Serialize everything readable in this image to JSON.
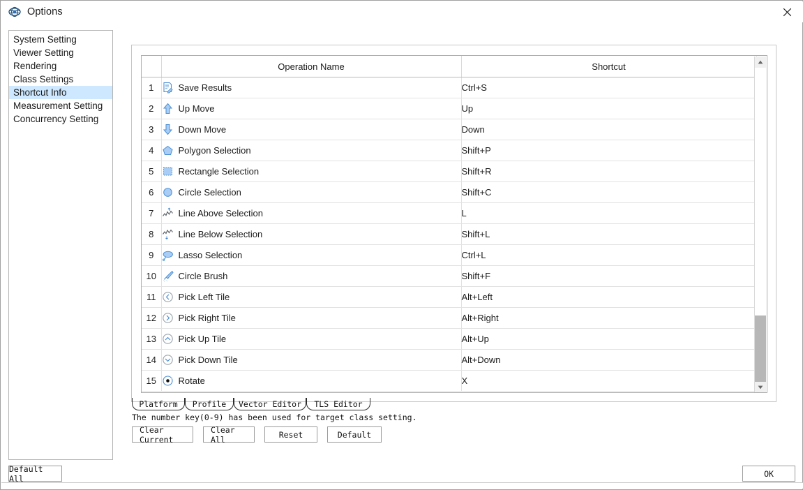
{
  "window": {
    "title": "Options",
    "app_icon": "app-logo-icon",
    "close_label": "✕"
  },
  "sidebar": {
    "items": [
      {
        "label": "System Setting",
        "selected": false
      },
      {
        "label": "Viewer Setting",
        "selected": false
      },
      {
        "label": "Rendering",
        "selected": false
      },
      {
        "label": "Class Settings",
        "selected": false
      },
      {
        "label": "Shortcut Info",
        "selected": true
      },
      {
        "label": "Measurement Setting",
        "selected": false
      },
      {
        "label": "Concurrency Setting",
        "selected": false
      }
    ],
    "selected_index": 4,
    "selection_color": "#cde8ff"
  },
  "table": {
    "headers": {
      "index": "",
      "operation": "Operation Name",
      "shortcut": "Shortcut"
    },
    "rows": [
      {
        "num": "1",
        "icon": "save-results-icon",
        "operation": "Save Results",
        "shortcut": "Ctrl+S"
      },
      {
        "num": "2",
        "icon": "arrow-up-icon",
        "operation": "Up Move",
        "shortcut": "Up"
      },
      {
        "num": "3",
        "icon": "arrow-down-icon",
        "operation": "Down Move",
        "shortcut": "Down"
      },
      {
        "num": "4",
        "icon": "polygon-icon",
        "operation": "Polygon Selection",
        "shortcut": "Shift+P"
      },
      {
        "num": "5",
        "icon": "rectangle-icon",
        "operation": "Rectangle Selection",
        "shortcut": "Shift+R"
      },
      {
        "num": "6",
        "icon": "circle-icon",
        "operation": "Circle Selection",
        "shortcut": "Shift+C"
      },
      {
        "num": "7",
        "icon": "line-above-icon",
        "operation": "Line Above Selection",
        "shortcut": "L"
      },
      {
        "num": "8",
        "icon": "line-below-icon",
        "operation": "Line Below Selection",
        "shortcut": "Shift+L"
      },
      {
        "num": "9",
        "icon": "lasso-icon",
        "operation": "Lasso Selection",
        "shortcut": "Ctrl+L"
      },
      {
        "num": "10",
        "icon": "brush-icon",
        "operation": "Circle Brush",
        "shortcut": "Shift+F"
      },
      {
        "num": "11",
        "icon": "chevron-left-circle-icon",
        "operation": "Pick Left Tile",
        "shortcut": "Alt+Left"
      },
      {
        "num": "12",
        "icon": "chevron-right-circle-icon",
        "operation": "Pick Right Tile",
        "shortcut": "Alt+Right"
      },
      {
        "num": "13",
        "icon": "chevron-up-circle-icon",
        "operation": "Pick Up Tile",
        "shortcut": "Alt+Up"
      },
      {
        "num": "14",
        "icon": "chevron-down-circle-icon",
        "operation": "Pick Down Tile",
        "shortcut": "Alt+Down"
      },
      {
        "num": "15",
        "icon": "rotate-icon",
        "operation": "Rotate",
        "shortcut": "X"
      }
    ]
  },
  "scrollbar": {
    "up_arrow": "▲",
    "down_arrow": "▼",
    "thumb_color": "#b7b7b7"
  },
  "tabs": [
    {
      "label": "Platform",
      "selected": true
    },
    {
      "label": "Profile",
      "selected": false
    },
    {
      "label": "Vector Editor",
      "selected": false
    },
    {
      "label": "TLS Editor",
      "selected": false
    }
  ],
  "hint": "The number key(0-9) has been used for target class setting.",
  "actions": [
    {
      "label": "Clear Current"
    },
    {
      "label": "Clear All"
    },
    {
      "label": "Reset"
    },
    {
      "label": "Default"
    }
  ],
  "footer": {
    "default_all": "Default All",
    "ok": "OK"
  },
  "colors": {
    "icon_blue": "#8fbdf0",
    "icon_blue_dark": "#2e6fb8",
    "selection": "#cde8ff",
    "border": "#b4b4b4"
  }
}
